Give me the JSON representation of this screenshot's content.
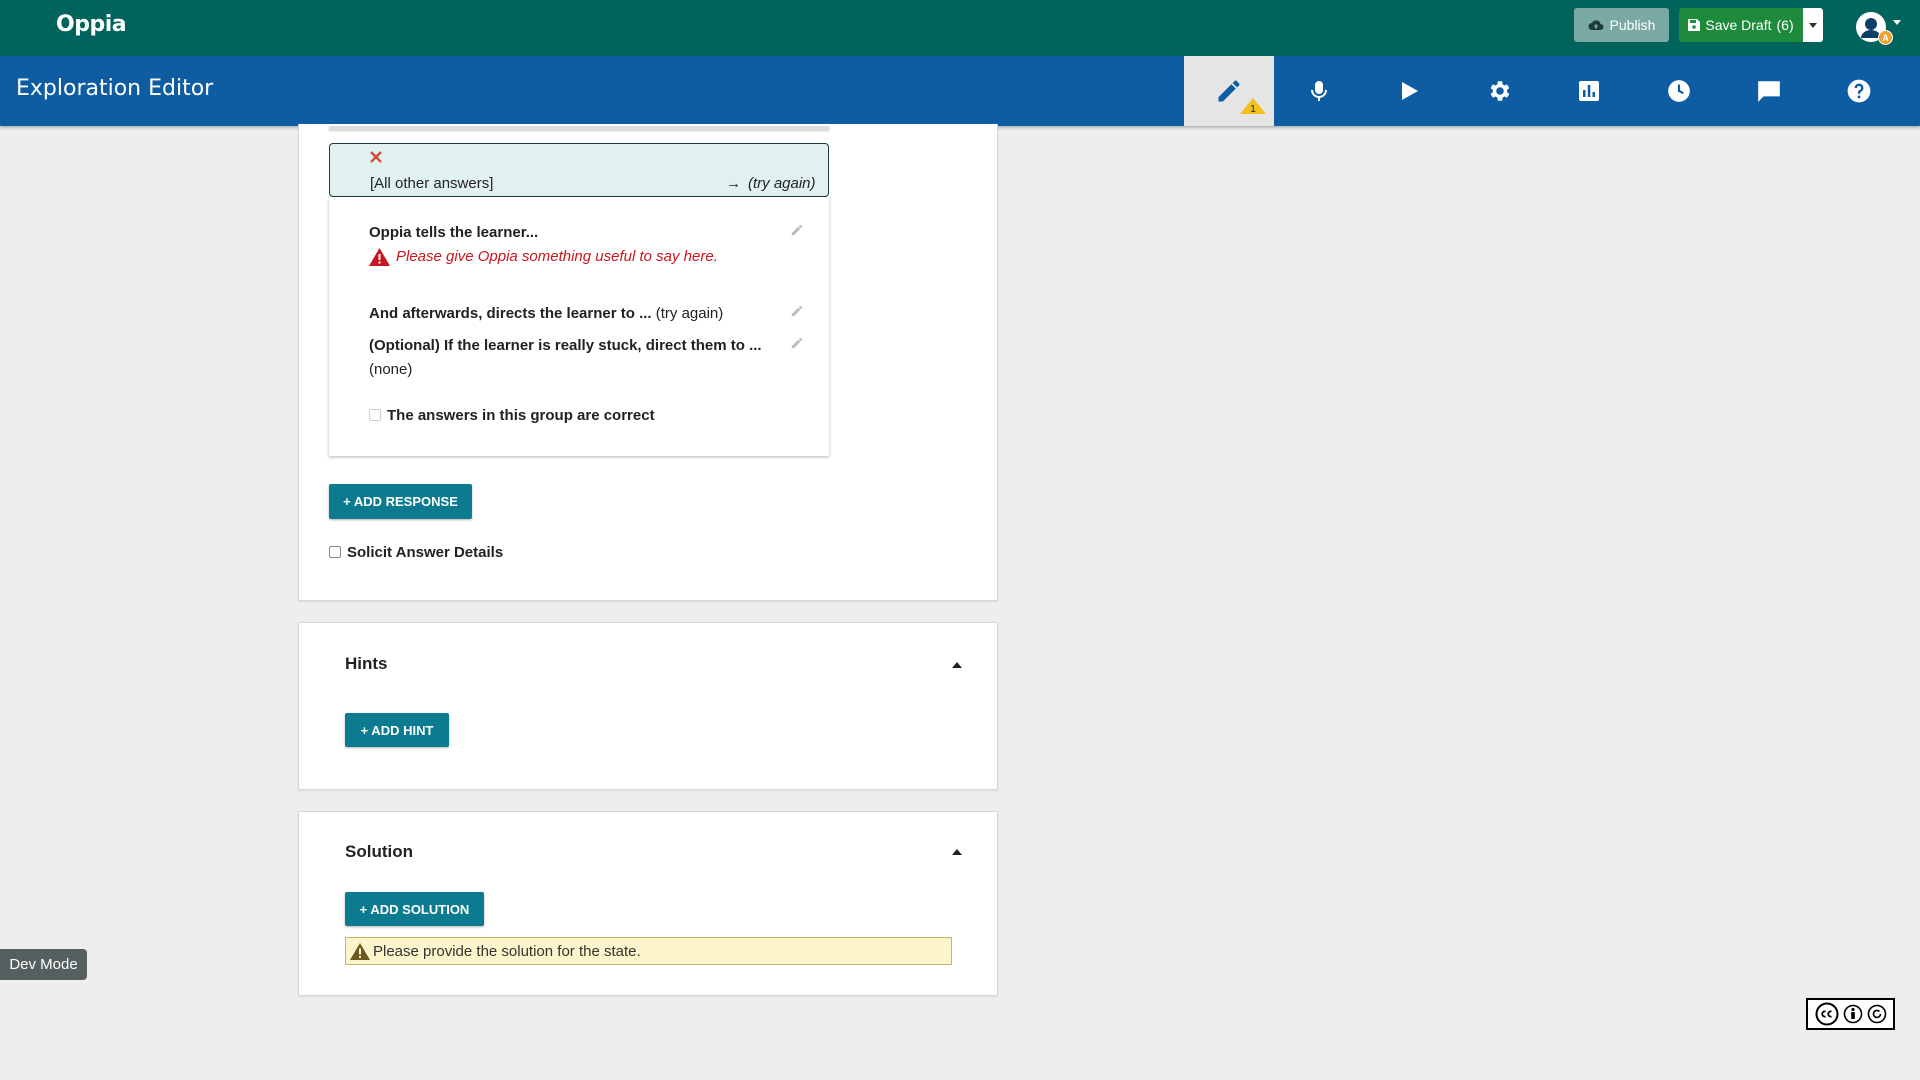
{
  "topbar": {
    "logo": "Oppia",
    "publish_label": "Publish",
    "save_label": "Save Draft",
    "save_count": "(6)",
    "avatar_badge": "A",
    "colors": {
      "bg": "#00645c",
      "publish": "#7aa9a4",
      "save": "#1d8a3c"
    }
  },
  "editorbar": {
    "title": "Exploration Editor",
    "tabs": [
      {
        "icon": "pencil-icon",
        "active": true,
        "warning_count": "1"
      },
      {
        "icon": "microphone-icon"
      },
      {
        "icon": "play-icon"
      },
      {
        "icon": "gear-icon"
      },
      {
        "icon": "bar-chart-icon"
      },
      {
        "icon": "clock-icon"
      },
      {
        "icon": "comment-icon"
      },
      {
        "icon": "help-icon"
      }
    ],
    "colors": {
      "bg": "#0e5da3"
    }
  },
  "response": {
    "header_text": "[All other answers]",
    "header_arrow": "→",
    "header_dest": "(try again)",
    "feedback_label": "Oppia tells the learner...",
    "feedback_warning": "Please give Oppia something useful to say here.",
    "afterwards_label": "And afterwards, directs the learner to ...",
    "afterwards_value": "(try again)",
    "stuck_label": "(Optional) If the learner is really stuck, direct them to ...",
    "stuck_value": "(none)",
    "correct_label": "The answers in this group are correct"
  },
  "interaction": {
    "add_response_label": "+ ADD RESPONSE",
    "solicit_label": "Solicit Answer Details"
  },
  "hints": {
    "title": "Hints",
    "add_label": "+ ADD HINT"
  },
  "solution": {
    "title": "Solution",
    "add_label": "+ ADD SOLUTION",
    "warning": "Please provide the solution for the state."
  },
  "footer": {
    "dev_mode": "Dev Mode"
  }
}
